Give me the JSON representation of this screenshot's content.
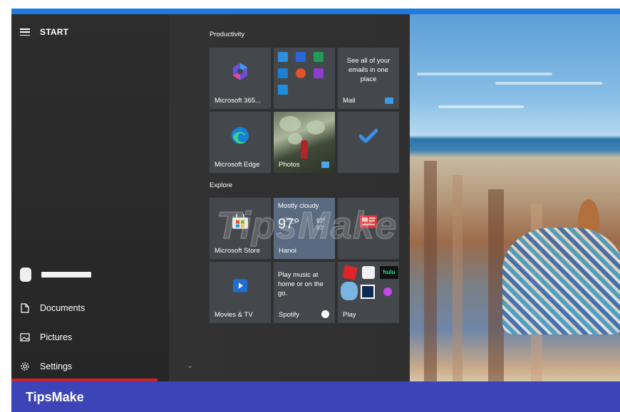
{
  "start_menu": {
    "header_label": "START",
    "user": {
      "name_redacted": true
    },
    "nav_items": [
      {
        "label": "Documents",
        "icon": "document-icon"
      },
      {
        "label": "Pictures",
        "icon": "pictures-icon"
      },
      {
        "label": "Settings",
        "icon": "gear-icon"
      }
    ]
  },
  "groups": {
    "productivity": "Productivity",
    "explore": "Explore"
  },
  "tiles": {
    "microsoft365": {
      "label": "Microsoft 365..."
    },
    "office_apps": {
      "label": ""
    },
    "mail": {
      "label": "Mail",
      "text": "See all of your emails in one place"
    },
    "edge": {
      "label": "Microsoft Edge"
    },
    "photos": {
      "label": "Photos"
    },
    "todo": {
      "label": ""
    },
    "store": {
      "label": "Microsoft Store"
    },
    "weather": {
      "condition": "Mostly cloudy",
      "temp": "97°",
      "high": "97°",
      "low": "83°",
      "location": "Hanoi"
    },
    "news": {
      "label": ""
    },
    "movies": {
      "label": "Movies & TV"
    },
    "spotify": {
      "label": "Spotify",
      "text": "Play music at home or on the go."
    },
    "play": {
      "label": "Play",
      "hulu": "hulu"
    }
  },
  "watermark": "TipsMake",
  "footer": {
    "brand": "TipsMake"
  },
  "colors": {
    "accent_blue": "#1f7ae0",
    "footer_bg": "#3d44b8",
    "settings_underline": "#d0202a",
    "tile_bg": "#44484d"
  }
}
